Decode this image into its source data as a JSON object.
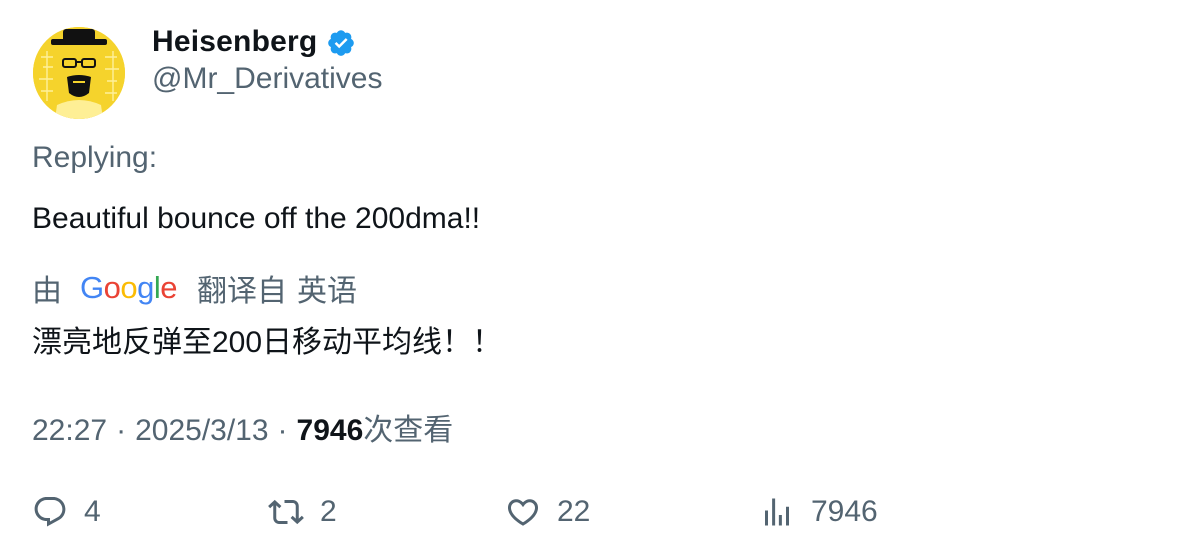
{
  "user": {
    "display_name": "Heisenberg",
    "handle": "@Mr_Derivatives",
    "verified": true
  },
  "replying_label": "Replying:",
  "tweet_text": "Beautiful bounce off the 200dma!!",
  "translation": {
    "prefix": "由",
    "provider": "Google",
    "label": "翻译自",
    "language": "英语",
    "text": "漂亮地反弹至200日移动平均线！！"
  },
  "meta": {
    "time": "22:27",
    "date": "2025/3/13",
    "separator": "·",
    "views_count": "7946",
    "views_label": "次查看"
  },
  "actions": {
    "replies": "4",
    "retweets": "2",
    "likes": "22",
    "views": "7946"
  },
  "colors": {
    "text_primary": "#0f1419",
    "text_secondary": "#536471",
    "verified_blue": "#1d9bf0",
    "avatar_yellow": "#f5d32c"
  },
  "icons": {
    "reply": "reply-icon",
    "retweet": "retweet-icon",
    "like": "heart-icon",
    "views": "views-icon",
    "verified": "verified-badge-icon"
  }
}
